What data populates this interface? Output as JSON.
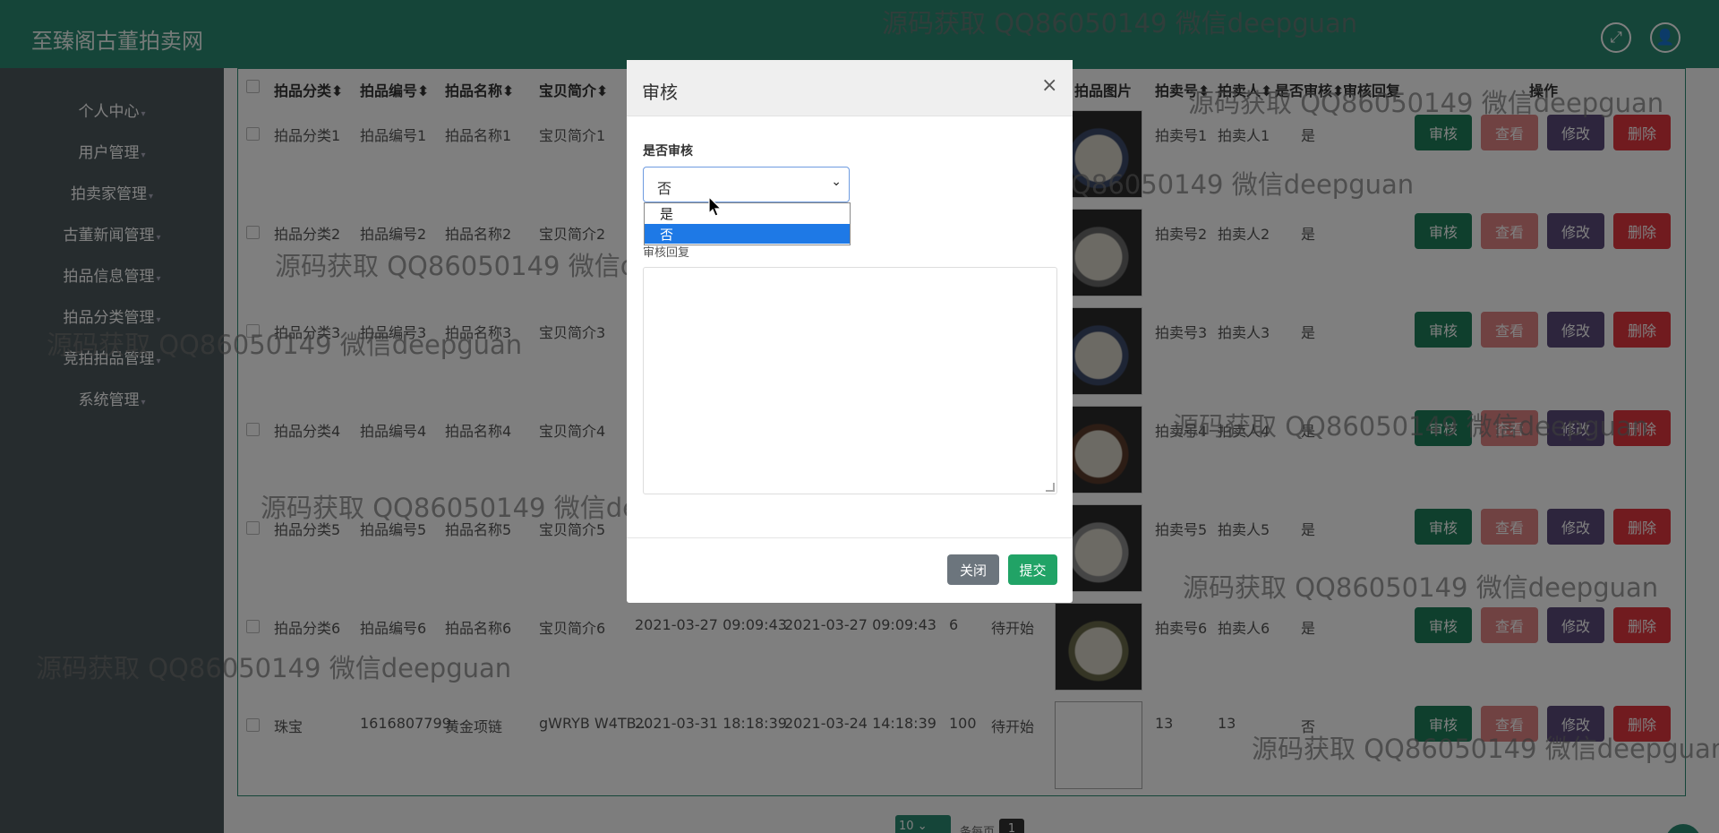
{
  "header": {
    "brand": "至臻阁古董拍卖网",
    "fullscreen_icon": "expand-icon",
    "user_icon": "user-icon"
  },
  "sidebar": {
    "items": [
      {
        "label": "个人中心"
      },
      {
        "label": "用户管理"
      },
      {
        "label": "拍卖家管理"
      },
      {
        "label": "古董新闻管理"
      },
      {
        "label": "拍品信息管理"
      },
      {
        "label": "拍品分类管理"
      },
      {
        "label": "竞拍拍品管理"
      },
      {
        "label": "系统管理"
      }
    ]
  },
  "table": {
    "headers": {
      "category": "拍品分类",
      "code": "拍品编号",
      "name": "拍品名称",
      "intro": "宝贝简介",
      "photo": "拍品图片",
      "auction_no": "拍卖号",
      "auctioneer": "拍卖人",
      "audited": "是否审核",
      "reply": "审核回复",
      "actions": "操作"
    },
    "rows": [
      {
        "category": "拍品分类1",
        "code": "拍品编号1",
        "name": "拍品名称1",
        "intro": "宝贝简介1",
        "start": "",
        "end": "",
        "price": "",
        "status": "",
        "auction_no": "拍卖号1",
        "auctioneer": "拍卖人1",
        "audited": "是"
      },
      {
        "category": "拍品分类2",
        "code": "拍品编号2",
        "name": "拍品名称2",
        "intro": "宝贝简介2",
        "start": "",
        "end": "",
        "price": "",
        "status": "",
        "auction_no": "拍卖号2",
        "auctioneer": "拍卖人2",
        "audited": "是"
      },
      {
        "category": "拍品分类3",
        "code": "拍品编号3",
        "name": "拍品名称3",
        "intro": "宝贝简介3",
        "start": "",
        "end": "",
        "price": "",
        "status": "",
        "auction_no": "拍卖号3",
        "auctioneer": "拍卖人3",
        "audited": "是"
      },
      {
        "category": "拍品分类4",
        "code": "拍品编号4",
        "name": "拍品名称4",
        "intro": "宝贝简介4",
        "start": "",
        "end": "",
        "price": "",
        "status": "",
        "auction_no": "拍卖号4",
        "auctioneer": "拍卖人4",
        "audited": "是"
      },
      {
        "category": "拍品分类5",
        "code": "拍品编号5",
        "name": "拍品名称5",
        "intro": "宝贝简介5",
        "start": "",
        "end": "",
        "price": "",
        "status": "",
        "auction_no": "拍卖号5",
        "auctioneer": "拍卖人5",
        "audited": "是"
      },
      {
        "category": "拍品分类6",
        "code": "拍品编号6",
        "name": "拍品名称6",
        "intro": "宝贝简介6",
        "start": "2021-03-27 09:09:43",
        "end": "2021-03-27 09:09:43",
        "price": "6",
        "status": "待开始",
        "auction_no": "拍卖号6",
        "auctioneer": "拍卖人6",
        "audited": "是"
      },
      {
        "category": "珠宝",
        "code": "1616807799",
        "name": "黄金项链",
        "intro": "gWRYB W4TB...",
        "start": "2021-03-31 18:18:39",
        "end": "2021-03-24 14:18:39",
        "price": "100",
        "status": "待开始",
        "auction_no": "13",
        "auctioneer": "13",
        "audited": "否"
      }
    ],
    "actions": {
      "audit": "审核",
      "view": "查看",
      "edit": "修改",
      "delete": "删除"
    }
  },
  "pager": {
    "page_size": "10",
    "per_page_label": "条每页",
    "current_page": "1"
  },
  "modal": {
    "title": "审核",
    "close_glyph": "×",
    "audit_label": "是否审核",
    "audit_value": "否",
    "options": [
      "是",
      "否"
    ],
    "reply_label": "审核回复",
    "reply_value": "",
    "close_button": "关闭",
    "submit_button": "提交"
  },
  "watermarks": {
    "text": "源码获取 QQ86050149 微信deepguan"
  },
  "colors": {
    "header": "#2b8a72",
    "sidebar": "#4d585d",
    "audit_button": "#1e7e5a",
    "view_button": "#e08585",
    "edit_button": "#5b4b7a",
    "delete_button": "#e2363f",
    "close_button": "#6c757d",
    "submit_button": "#21a366",
    "option_highlight": "#1e79e6"
  }
}
